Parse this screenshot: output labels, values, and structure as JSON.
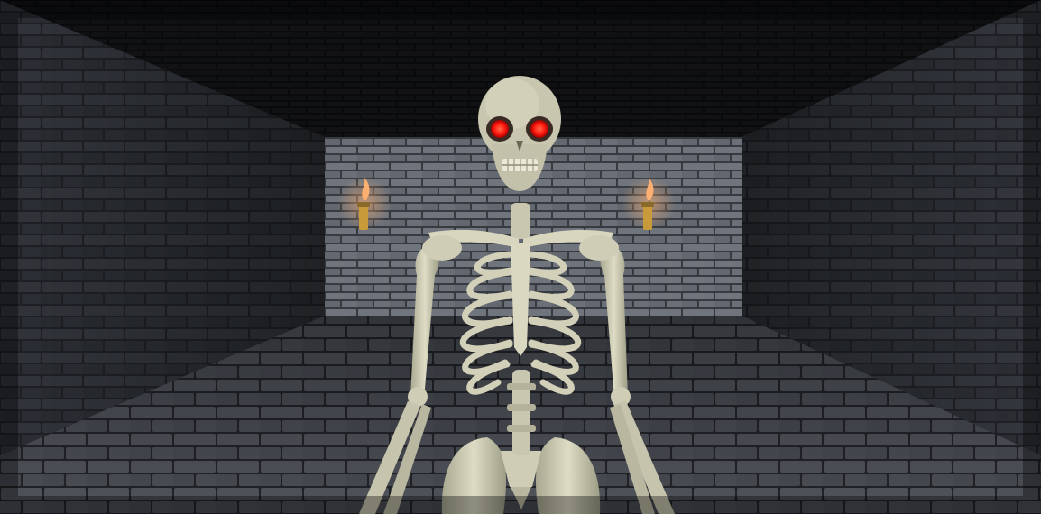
{
  "scene": {
    "kind": "dungeon corridor",
    "palette": {
      "ceiling": "#151618",
      "brick_dark": "#2c2f35",
      "brick_mid": "#4e535b",
      "mortar": "#1b1c1f",
      "back_wall": "#6b707a",
      "back_mortar": "#3a3d43",
      "floor": "#3f434a",
      "floor_mortar": "#24262a",
      "moss": "#5a5a2c",
      "bone": "#d6d5bd",
      "bone_shade": "#9c9b84",
      "eye_glow": "#ff2a1a",
      "torch_metal": "#c89a3a",
      "flame": "#ffb070"
    },
    "torches": [
      {
        "side": "left",
        "lit": true
      },
      {
        "side": "right",
        "lit": true
      }
    ],
    "enemy": {
      "type": "skeleton",
      "eyes": "glowing red",
      "facing": "viewer"
    }
  }
}
